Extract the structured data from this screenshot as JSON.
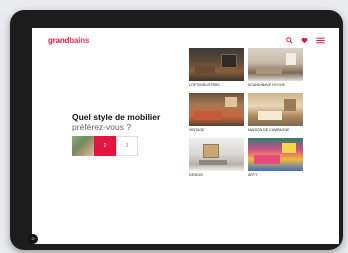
{
  "header": {
    "logo_part1": "grand",
    "logo_part2": "bains",
    "icons": [
      "search-icon",
      "heart-icon",
      "menu-icon"
    ],
    "accent_color": "#e1153f"
  },
  "question": {
    "line1": "Quel style de mobilier",
    "line2": "préférez-vous ?"
  },
  "steps": {
    "current": "2",
    "next": "3"
  },
  "styles": [
    {
      "label": "LOFT/INDUSTRIEL"
    },
    {
      "label": "SCANDINAVE HYGGE"
    },
    {
      "label": "VINTAGE"
    },
    {
      "label": "MAISON DE CAMPAGNE"
    },
    {
      "label": "DESIGN"
    },
    {
      "label": "ARTY"
    }
  ],
  "cookie_badge": "⊙"
}
